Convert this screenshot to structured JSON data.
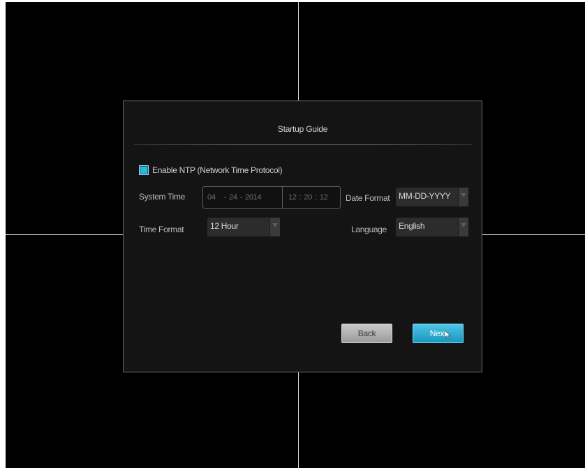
{
  "dialog": {
    "title": "Startup Guide",
    "ntp": {
      "label": "Enable NTP (Network Time Protocol)",
      "checked": true
    },
    "system_time": {
      "label": "System Time",
      "month": "04",
      "day": "24",
      "year": "2014",
      "date_sep": "-",
      "hour": "12",
      "minute": "20",
      "second": "12",
      "time_sep": ":"
    },
    "date_format": {
      "label": "Date Format",
      "value": "MM-DD-YYYY"
    },
    "time_format": {
      "label": "Time Format",
      "value": "12 Hour"
    },
    "language": {
      "label": "Language",
      "value": "English"
    },
    "buttons": {
      "back": "Back",
      "next": "Next"
    }
  },
  "icons": {
    "dropdown": "chevron-down-icon",
    "cursor": "mouse-pointer-icon",
    "checkbox": "checkbox-checked-icon"
  },
  "colors": {
    "accent": "#2eb6d6",
    "background": "#000000",
    "dialog": "#141414"
  }
}
